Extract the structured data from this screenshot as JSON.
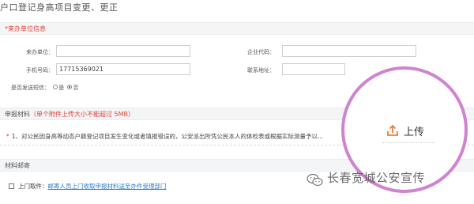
{
  "page": {
    "title": "户口登记身高项目变更、更正"
  },
  "section_unit": {
    "star": "*",
    "title": "来办单位信息",
    "fields": {
      "unit_label": "来办单位：",
      "unit_value": "",
      "org_code_label": "企业代码：",
      "org_code_value": "",
      "phone_label": "手机号码：",
      "phone_value": "17715369021",
      "address_label": "联系地址：",
      "address_value": "",
      "sms_label": "是否发送短信：",
      "sms_no": "是",
      "sms_yes": "否"
    }
  },
  "section_materials": {
    "title": "申报材料",
    "note": "（单个附件上传大小不能超过 5MB）",
    "doc_star": "*",
    "doc_text": "1、对公民因身高等动态户籍登记项目发生变化或者填报错误的，公安派出所凭公民本人的体检表或根据实际测量予以...",
    "upload_label": "上传"
  },
  "section_mail": {
    "title": "材料邮寄",
    "pickup_label": "上门取件：",
    "pickup_text": "邮寄人员上门收取申报材料送至办件受理部门"
  },
  "watermark": {
    "text": "长春宽城公安宣传"
  },
  "colors": {
    "magnifier_ring": "#d083cf",
    "upload_icon": "#f07c39",
    "required_red": "#e0443a",
    "link_blue": "#2b7bd0"
  },
  "icons": {
    "upload": "upload-icon",
    "wechat": "wechat-icon"
  }
}
